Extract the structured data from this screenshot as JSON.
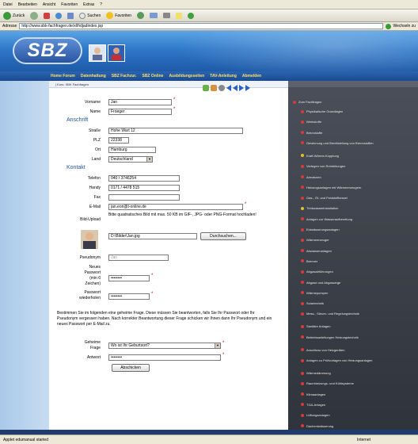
{
  "browser": {
    "menu": [
      "Datei",
      "Bearbeiten",
      "Ansicht",
      "Favoriten",
      "Extras",
      "?"
    ],
    "toolbar": {
      "back": "Zurück",
      "search": "Suchen",
      "favorites": "Favoriten"
    },
    "address_label": "Adresse",
    "address": "http://www.sbk-fachfragen.de/xl/hdjadindex.jsp",
    "go": "Wechseln zu",
    "status": "Applet edumanual started",
    "status_zone": "Internet"
  },
  "site": {
    "logo": "SBZ",
    "nav": [
      "Home Forum",
      "Datenhaltung",
      "SBZ Fachzur.",
      "SBZ Online",
      "Ausbildungsseiten",
      "TAV-Anleitung",
      "Abmelden"
    ],
    "breadcrumb": "| Kurs: SBK Fachfragen"
  },
  "form": {
    "vorname": {
      "label": "Vorname",
      "value": "Jan"
    },
    "name": {
      "label": "Name",
      "value": "Froeger"
    },
    "section_address": "Anschrift",
    "strasse": {
      "label": "Straße",
      "value": "Hohe Wart 12"
    },
    "plz": {
      "label": "PLZ",
      "value": "22338"
    },
    "ort": {
      "label": "Ort",
      "value": "Hamburg"
    },
    "land": {
      "label": "Land",
      "value": "Deutschland"
    },
    "section_contact": "Kontakt",
    "telefon": {
      "label": "Telefon",
      "value": "040 / 3746254"
    },
    "handy": {
      "label": "Handy",
      "value": "0171 / 4478 515"
    },
    "fax": {
      "label": "Fax",
      "value": ""
    },
    "email": {
      "label": "E-Mail",
      "value": "jan.eon@t-online.de"
    },
    "bild_upload": {
      "label": "Bild-Upload",
      "hint": "Bitte quadratisches Bild mit max. 50 KB im GIF-, JPG- oder PNG-Format hochladen!",
      "path": "D:\\Bilder\\Jan.jpg",
      "browse": "Durchsuchen..."
    },
    "pseudonym": {
      "label": "Pseudonym",
      "value": "Jan"
    },
    "new_password": {
      "label_lines": [
        "Neues",
        "Passwort",
        "(min 6",
        "Zeichen)"
      ],
      "value": "••••••••"
    },
    "repeat_password": {
      "label_lines": [
        "Passwort",
        "wiederholen"
      ],
      "value": "••••••••"
    },
    "secret_note": "Bestimmen Sie im folgenden eine geheime Frage. Diese müssen Sie beantworten, falls Sie Ihr Passwort oder Ihr Pseudonym vergessen haben. Nach korrekter Beantwortung dieser Frage schicken wir Ihnen dann Ihr Pseudonym und ein neues Passwort per E-Mail zu.",
    "secret_question": {
      "label_lines": [
        "Geheime",
        "Frage"
      ],
      "value": "Wo ist Ihr Geburtsort?"
    },
    "answer": {
      "label": "Antwort",
      "value": "••••••••"
    },
    "submit": "Abschicken"
  },
  "sidebar": {
    "title": "Zum Fachfragen",
    "items": [
      {
        "text": "Physikalische Grundlagen",
        "color": "red"
      },
      {
        "text": "Werkstoffe",
        "color": "red"
      },
      {
        "text": "Brennstoffe",
        "color": "red"
      },
      {
        "text": "Gewinnung und Bereitstellung von Brennstoffen",
        "color": "red"
      },
      {
        "text": "Kraft-Wärme-Kopplung",
        "color": "yellow"
      },
      {
        "text": "Verlegen von Rohrleitungen",
        "color": "red"
      },
      {
        "text": "Armaturen",
        "color": "red"
      },
      {
        "text": "Heizungsanlagen mit Wärmeerzeugern",
        "color": "red"
      },
      {
        "text": "Gas-, Öl- und Feststoffkessel",
        "color": "red"
      },
      {
        "text": "Trinkwasserinstallation",
        "color": "yellow"
      },
      {
        "text": "Anlagen zur Wasseraufbereitung",
        "color": "red"
      },
      {
        "text": "Entwässerungsanlagen",
        "color": "red"
      },
      {
        "text": "Wärmeerzeuger",
        "color": "red"
      },
      {
        "text": "Abwasseranlagen",
        "color": "red"
      },
      {
        "text": "Brenner",
        "color": "red"
      },
      {
        "text": "Abgasabführungen",
        "color": "red"
      },
      {
        "text": "Abgase und Abgaswege",
        "color": "red"
      },
      {
        "text": "Wärmepumpen",
        "color": "red"
      },
      {
        "text": "Solartechnik",
        "color": "red"
      },
      {
        "text": "Mess-, Steuer- und Regelungstechnik",
        "color": "red"
      },
      {
        "text": "Sanitäre Anlagen",
        "color": "red"
      },
      {
        "text": "Betriebsanleitungen Heizungstechnik",
        "color": "red"
      },
      {
        "text": "Anschluss von Heizgeräten",
        "color": "red"
      },
      {
        "text": "Anlagen zu Prüfvorlagen von Heizungsanlagen",
        "color": "red"
      },
      {
        "text": "Wärmedämmung",
        "color": "red"
      },
      {
        "text": "Raumheizungs- und Kühlsysteme",
        "color": "red"
      },
      {
        "text": "Klimaanlagen",
        "color": "red"
      },
      {
        "text": "TGA-Anlagen",
        "color": "red"
      },
      {
        "text": "Lüftungsanlagen",
        "color": "red"
      },
      {
        "text": "Dachentwässerung",
        "color": "red"
      }
    ]
  }
}
